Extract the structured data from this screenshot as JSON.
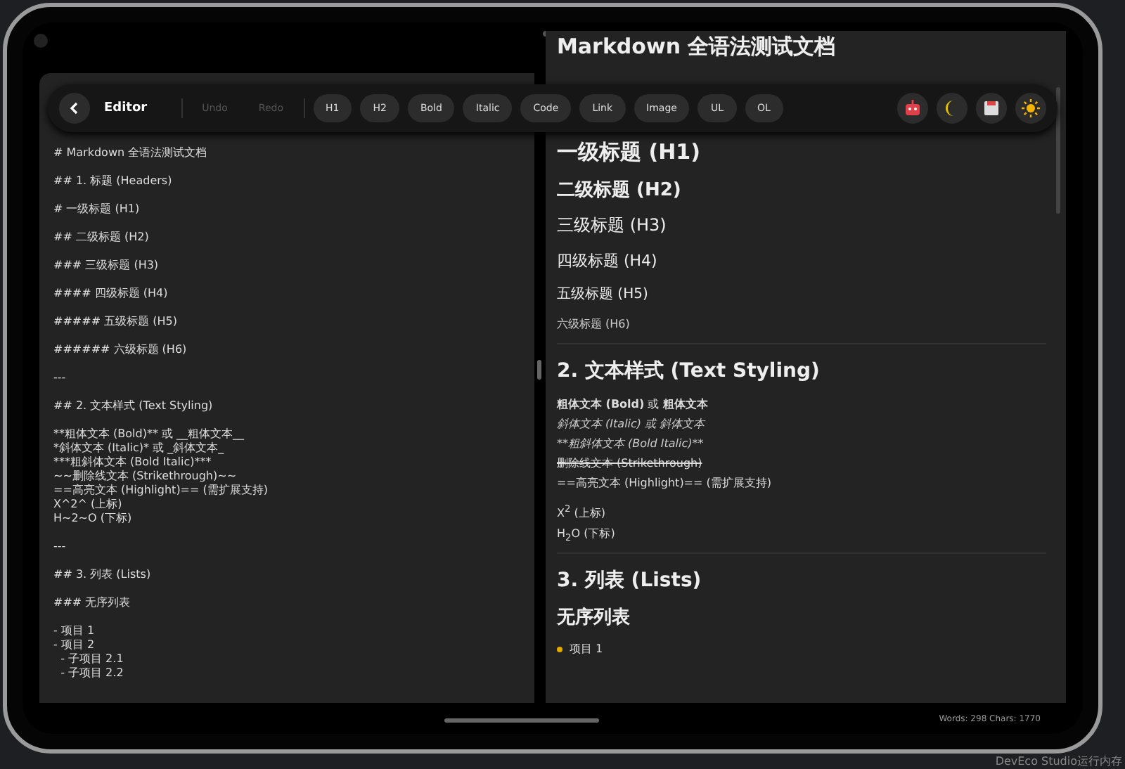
{
  "toolbar": {
    "title": "Editor",
    "history": [
      {
        "label": "Undo",
        "disabled": true
      },
      {
        "label": "Redo",
        "disabled": true
      }
    ],
    "formats": [
      "H1",
      "H2",
      "Bold",
      "Italic",
      "Code",
      "Link",
      "Image",
      "UL",
      "OL"
    ],
    "actions": [
      {
        "kind": "robot"
      },
      {
        "kind": "moon"
      },
      {
        "kind": "save"
      },
      {
        "kind": "sun"
      }
    ]
  },
  "editor": {
    "blocks": [
      [
        "# Markdown 全语法测试文档"
      ],
      [
        "## 1. 标题 (Headers)"
      ],
      [
        "# 一级标题 (H1)"
      ],
      [
        "## 二级标题 (H2)"
      ],
      [
        "### 三级标题 (H3)"
      ],
      [
        "#### 四级标题 (H4)"
      ],
      [
        "##### 五级标题 (H5)"
      ],
      [
        "###### 六级标题 (H6)"
      ],
      [
        "---"
      ],
      [
        "## 2. 文本样式 (Text Styling)"
      ],
      [
        "**粗体文本 (Bold)** 或 __粗体文本__",
        "*斜体文本 (Italic)* 或 _斜体文本_",
        "***粗斜体文本 (Bold Italic)***",
        "~~删除线文本 (Strikethrough)~~",
        "==高亮文本 (Highlight)== (需扩展支持)",
        "X^2^ (上标)",
        "H~2~O (下标)"
      ],
      [
        "---"
      ],
      [
        "## 3. 列表 (Lists)"
      ],
      [
        "### 无序列表"
      ],
      [
        "- 项目 1",
        "- 项目 2",
        "  - 子项目 2.1",
        "  - 子项目 2.2"
      ]
    ]
  },
  "preview": [
    {
      "kind": "h1",
      "text": "Markdown 全语法测试文档"
    },
    {
      "kind": "h1",
      "text": "一级标题 (H1)"
    },
    {
      "kind": "h2",
      "text": "二级标题 (H2)"
    },
    {
      "kind": "h3",
      "text": "三级标题 (H3)"
    },
    {
      "kind": "h4",
      "text": "四级标题 (H4)"
    },
    {
      "kind": "h5",
      "text": "五级标题 (H5)"
    },
    {
      "kind": "h6",
      "text": "六级标题 (H6)"
    },
    {
      "kind": "hr"
    },
    {
      "kind": "h2big",
      "text": "2. 文本样式 (Text Styling)"
    },
    {
      "kind": "p",
      "text": "**粗体文本 (Bold)** 或 **粗体文本**"
    },
    {
      "kind": "italic",
      "text": "斜体文本 (Italic) 或 斜体文本"
    },
    {
      "kind": "italic",
      "text": "**粗斜体文本 (Bold Italic)**"
    },
    {
      "kind": "strike",
      "text": "删除线文本 (Strikethrough)"
    },
    {
      "kind": "p",
      "text": "==高亮文本 (Highlight)== (需扩展支持)"
    },
    {
      "kind": "gap"
    },
    {
      "kind": "p",
      "text": "X$^{2}$ (上标)"
    },
    {
      "kind": "p",
      "text": "H$_{2}$O (下标)"
    },
    {
      "kind": "hr"
    },
    {
      "kind": "h2big",
      "text": "3. 列表 (Lists)"
    },
    {
      "kind": "h2",
      "text": "无序列表"
    },
    {
      "kind": "li",
      "text": "项目 1"
    }
  ],
  "status": "Words: 298  Chars: 1770",
  "ide_footer": "DevEco Studio运行内存"
}
